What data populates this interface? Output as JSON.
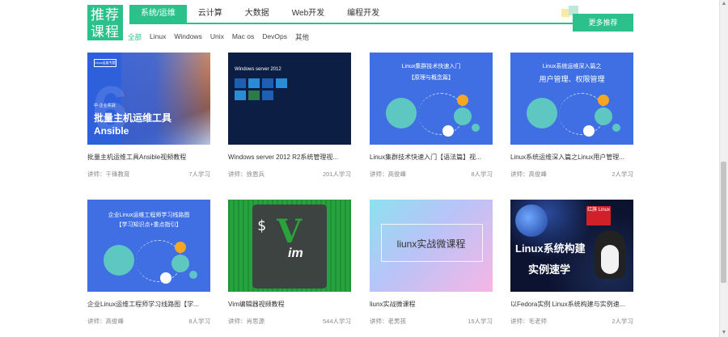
{
  "header": {
    "logo_line1": "推荐",
    "logo_line2": "课程",
    "tabs": [
      "系统/运维",
      "云计算",
      "大数据",
      "Web开发",
      "编程开发"
    ],
    "subtabs": [
      "全部",
      "Linux",
      "Windows",
      "Unix",
      "Mac os",
      "DevOps",
      "其他"
    ],
    "more_button": "更多推荐",
    "accent_color": "#2cc08a"
  },
  "courses": [
    {
      "title": "批量主机运维工具Ansible视频教程",
      "teacher": "讲师：千锋教育",
      "learners": "7人学习",
      "thumb": {
        "tag": "Linux运维专题",
        "line1": "中·企业实战",
        "line2": "批量主机运维工具",
        "line3": "Ansible"
      }
    },
    {
      "title": "Windows server 2012 R2系统管理视...",
      "teacher": "讲师：徐恩兵",
      "learners": "201人学习",
      "thumb": {
        "heading": "Windows server 2012"
      }
    },
    {
      "title": "Linux集群技术快速入门【语法篇】视...",
      "teacher": "讲师：高俊峰",
      "learners": "8人学习",
      "thumb": {
        "line1": "Linux集群技术快速入门",
        "line2": "【原理与概念篇】"
      }
    },
    {
      "title": "Linux系统运维深入篇之Linux用户管理...",
      "teacher": "讲师：高俊峰",
      "learners": "2人学习",
      "thumb": {
        "line1": "Linux系统运维深入篇之",
        "line2": "用户管理、权限管理"
      }
    },
    {
      "title": "企业Linux运维工程师学习线路图【学...",
      "teacher": "讲师：高俊峰",
      "learners": "8人学习",
      "thumb": {
        "line1": "企业Linux运维工程师学习线路图",
        "line2": "【学习知识点+重点指引】"
      }
    },
    {
      "title": "Vim编辑器视频教程",
      "teacher": "讲师：肖思源",
      "learners": "544人学习",
      "thumb": {
        "dollar": "$",
        "logo": "V",
        "word": "im"
      }
    },
    {
      "title": "liunx实战微课程",
      "teacher": "讲师：老男孩",
      "learners": "15人学习",
      "thumb": {
        "text": "liunx实战微课程"
      }
    },
    {
      "title": "以Fedora实例 Linux系统构建与实例速...",
      "teacher": "讲师：毛老师",
      "learners": "2人学习",
      "thumb": {
        "flag": "红旗 Linux",
        "line1": "Linux系统构建",
        "line2": "实例速学"
      }
    }
  ]
}
